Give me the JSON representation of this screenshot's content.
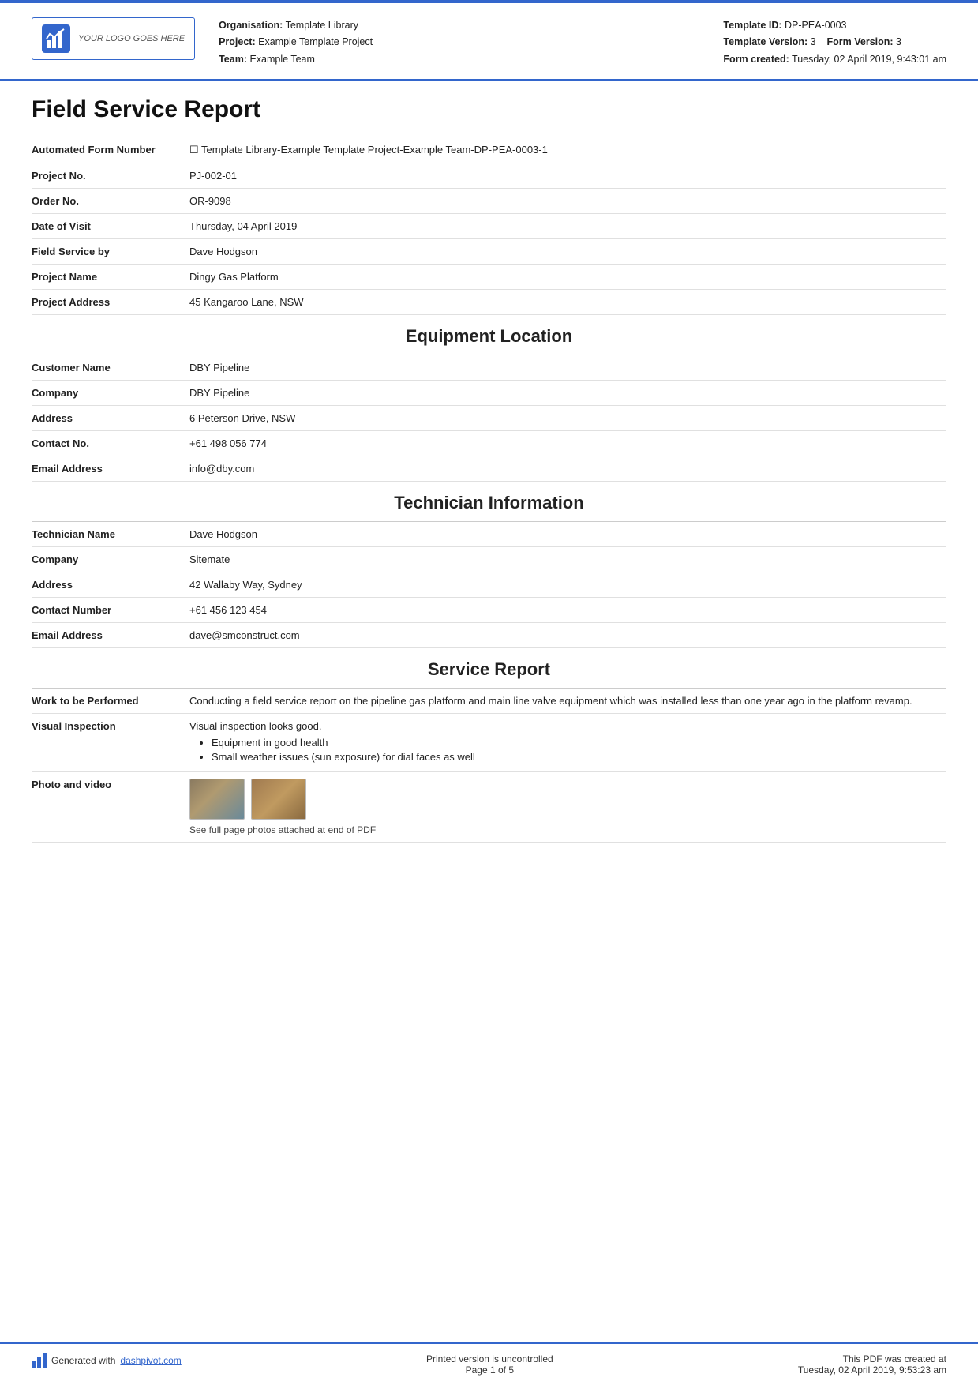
{
  "header": {
    "logo_text": "YOUR LOGO GOES HERE",
    "org_label": "Organisation:",
    "org_value": "Template Library",
    "project_label": "Project:",
    "project_value": "Example Template Project",
    "team_label": "Team:",
    "team_value": "Example Team",
    "template_id_label": "Template ID:",
    "template_id_value": "DP-PEA-0003",
    "template_version_label": "Template Version:",
    "template_version_value": "3",
    "form_version_label": "Form Version:",
    "form_version_value": "3",
    "form_created_label": "Form created:",
    "form_created_value": "Tuesday, 02 April 2019, 9:43:01 am"
  },
  "page_title": "Field Service Report",
  "form_fields": [
    {
      "label": "Automated Form Number",
      "value": "☐ Template Library-Example Template Project-Example Team-DP-PEA-0003-1"
    },
    {
      "label": "Project No.",
      "value": "PJ-002-01"
    },
    {
      "label": "Order No.",
      "value": "OR-9098"
    },
    {
      "label": "Date of Visit",
      "value": "Thursday, 04 April 2019"
    },
    {
      "label": "Field Service by",
      "value": "Dave Hodgson"
    },
    {
      "label": "Project Name",
      "value": "Dingy Gas Platform"
    },
    {
      "label": "Project Address",
      "value": "45 Kangaroo Lane, NSW"
    }
  ],
  "equipment_section": {
    "heading": "Equipment Location",
    "fields": [
      {
        "label": "Customer Name",
        "value": "DBY Pipeline"
      },
      {
        "label": "Company",
        "value": "DBY Pipeline"
      },
      {
        "label": "Address",
        "value": "6 Peterson Drive, NSW"
      },
      {
        "label": "Contact No.",
        "value": "+61 498 056 774"
      },
      {
        "label": "Email Address",
        "value": "info@dby.com"
      }
    ]
  },
  "technician_section": {
    "heading": "Technician Information",
    "fields": [
      {
        "label": "Technician Name",
        "value": "Dave Hodgson"
      },
      {
        "label": "Company",
        "value": "Sitemate"
      },
      {
        "label": "Address",
        "value": "42 Wallaby Way, Sydney"
      },
      {
        "label": "Contact Number",
        "value": "+61 456 123 454"
      },
      {
        "label": "Email Address",
        "value": "dave@smconstruct.com"
      }
    ]
  },
  "service_section": {
    "heading": "Service Report",
    "fields": [
      {
        "label": "Work to be Performed",
        "value": "Conducting a field service report on the pipeline gas platform and main line valve equipment which was installed less than one year ago in the platform revamp."
      },
      {
        "label": "Visual Inspection",
        "value": "Visual inspection looks good.",
        "bullets": [
          "Equipment in good health",
          "Small weather issues (sun exposure) for dial faces as well"
        ]
      },
      {
        "label": "Photo and video",
        "photo_caption": "See full page photos attached at end of PDF"
      }
    ]
  },
  "footer": {
    "generated_text": "Generated with",
    "link_text": "dashpivot.com",
    "uncontrolled_text": "Printed version is uncontrolled",
    "page_text": "Page 1 of 5",
    "pdf_created_text": "This PDF was created at",
    "pdf_created_date": "Tuesday, 02 April 2019, 9:53:23 am"
  }
}
